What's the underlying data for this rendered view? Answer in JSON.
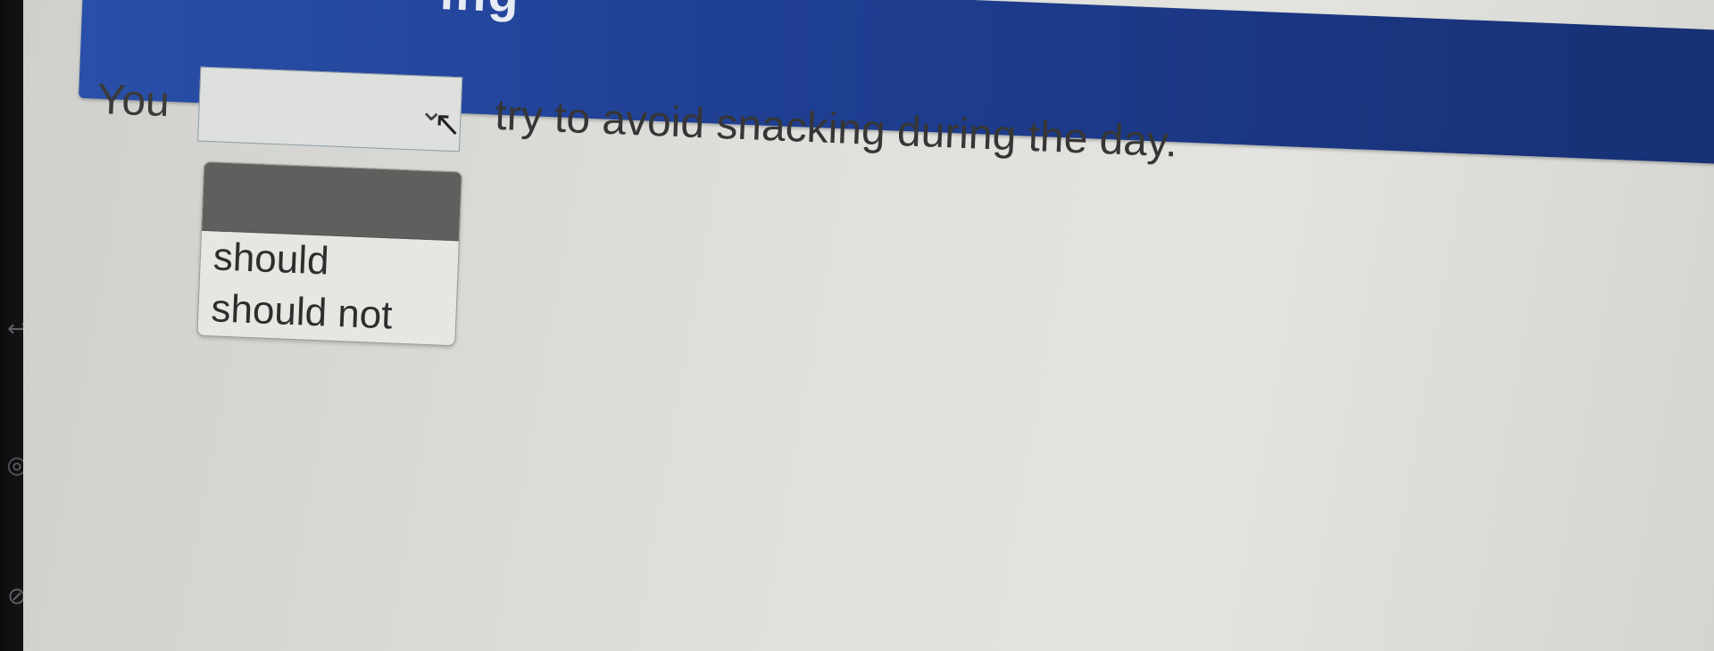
{
  "header": {
    "title": "ing"
  },
  "exercise": {
    "prefix": "You",
    "suffix": "try to avoid snacking during the day.",
    "select": {
      "value": "",
      "chevron_icon": "chevron-down-icon",
      "cursor_icon": "mouse-pointer-icon",
      "options": [
        "",
        "should",
        "should not"
      ]
    }
  },
  "sidebar": {
    "icons": [
      "back-arrow-icon",
      "eye-icon",
      "eye-slash-icon"
    ]
  }
}
